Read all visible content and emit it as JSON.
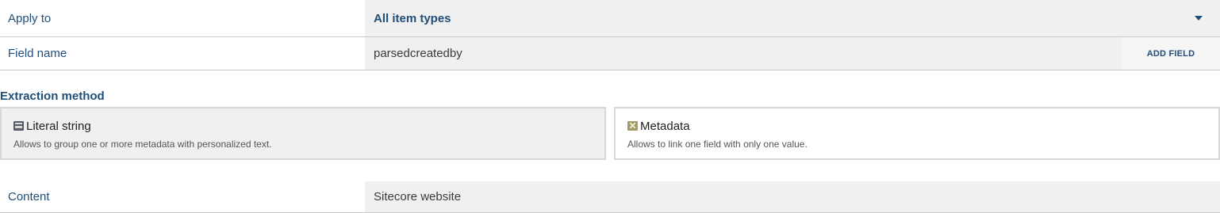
{
  "apply_to": {
    "label": "Apply to",
    "value": "All item types"
  },
  "field_name": {
    "label": "Field name",
    "value": "parsedcreatedby",
    "add_button": "ADD FIELD"
  },
  "extraction": {
    "title": "Extraction method",
    "options": [
      {
        "label": "Literal string",
        "description": "Allows to group one or more metadata with personalized text.",
        "icon": "literal-string-icon",
        "selected": true
      },
      {
        "label": "Metadata",
        "description": "Allows to link one field with only one value.",
        "icon": "metadata-icon",
        "selected": false
      }
    ]
  },
  "content": {
    "label": "Content",
    "value": "Sitecore website"
  },
  "colors": {
    "accent": "#1f4e79",
    "field_background": "#f0f0f0",
    "border": "#c9c9c9"
  }
}
